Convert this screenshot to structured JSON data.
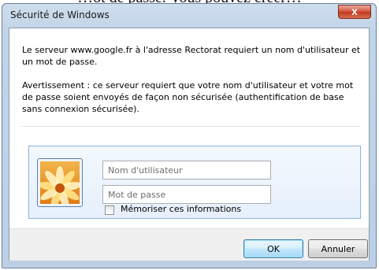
{
  "background_text": "…ot de passe. Vous pouvez créer…",
  "window": {
    "title": "Sécurité de Windows",
    "close_glyph": "x"
  },
  "message": {
    "line1": "Le serveur www.google.fr à l'adresse Rectorat requiert un nom d'utilisateur et un mot de passe.",
    "warning": "Avertissement : ce serveur requiert que votre nom d'utilisateur et votre mot de passe soient envoyés de façon non sécurisée (authentification de base sans connexion sécurisée)."
  },
  "credentials": {
    "username_placeholder": "Nom d'utilisateur",
    "username_value": "",
    "password_placeholder": "Mot de passe",
    "password_value": "",
    "remember_label": "Mémoriser ces informations",
    "remember_checked": false
  },
  "buttons": {
    "ok": "OK",
    "cancel": "Annuler"
  },
  "icons": {
    "user_tile": "flower-user-tile-icon",
    "close": "close-icon"
  },
  "colors": {
    "accent": "#3c7fb1",
    "panel_border": "#8cb2d8",
    "close_red": "#c0391f"
  }
}
